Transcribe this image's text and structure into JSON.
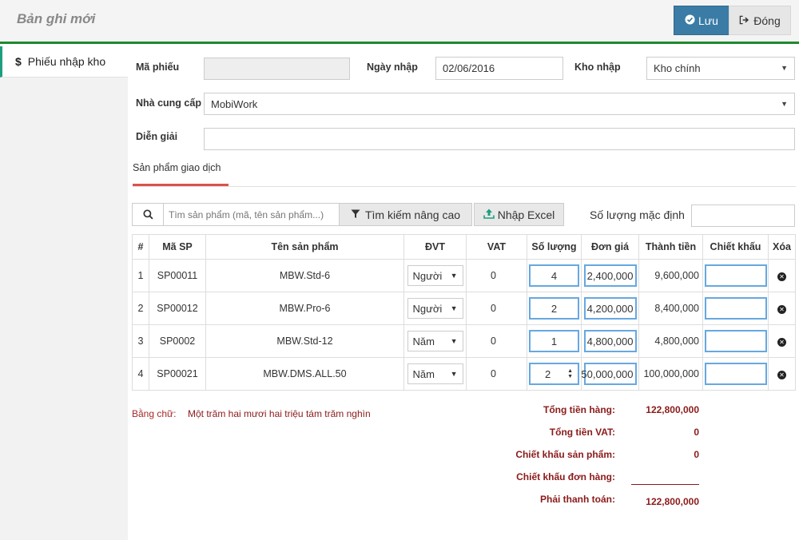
{
  "header": {
    "title": "Bản ghi mới",
    "save_label": "Lưu",
    "close_label": "Đóng"
  },
  "sidebar": {
    "items": [
      {
        "icon": "dollar-icon",
        "label": "Phiếu nhập kho"
      }
    ]
  },
  "form": {
    "ma_phieu_label": "Mã phiếu",
    "ma_phieu_value": "",
    "ngay_nhap_label": "Ngày nhập",
    "ngay_nhap_value": "02/06/2016",
    "kho_nhap_label": "Kho nhập",
    "kho_nhap_value": "Kho chính",
    "nha_cung_cap_label": "Nhà cung cấp",
    "nha_cung_cap_value": "MobiWork",
    "dien_giai_label": "Diễn giải",
    "dien_giai_value": ""
  },
  "tabs": {
    "active": "Sản phẩm giao dịch"
  },
  "toolbar": {
    "search_placeholder": "Tìm sản phẩm (mã, tên sản phẩm...)",
    "advanced_search_label": "Tìm kiếm nâng cao",
    "import_excel_label": "Nhập Excel",
    "default_qty_label": "Số lượng mặc định",
    "default_qty_value": ""
  },
  "table": {
    "headers": [
      "#",
      "Mã SP",
      "Tên sản phẩm",
      "ĐVT",
      "VAT",
      "Số lượng",
      "Đơn giá",
      "Thành tiền",
      "Chiết khấu",
      "Xóa"
    ],
    "rows": [
      {
        "no": "1",
        "code": "SP00011",
        "name": "MBW.Std-6",
        "unit": "Người",
        "vat": "0",
        "qty": "4",
        "price": "2,400,000",
        "total": "9,600,000",
        "discount": ""
      },
      {
        "no": "2",
        "code": "SP00012",
        "name": "MBW.Pro-6",
        "unit": "Người",
        "vat": "0",
        "qty": "2",
        "price": "4,200,000",
        "total": "8,400,000",
        "discount": ""
      },
      {
        "no": "3",
        "code": "SP0002",
        "name": "MBW.Std-12",
        "unit": "Năm",
        "vat": "0",
        "qty": "1",
        "price": "4,800,000",
        "total": "4,800,000",
        "discount": ""
      },
      {
        "no": "4",
        "code": "SP00021",
        "name": "MBW.DMS.ALL.50",
        "unit": "Năm",
        "vat": "0",
        "qty": "2",
        "price": "50,000,000",
        "total": "100,000,000",
        "discount": ""
      }
    ]
  },
  "summary": {
    "words_label": "Bằng chữ:",
    "words_value": "Một trăm hai mươi hai triệu tám trăm nghìn",
    "tong_tien_hang_label": "Tổng tiền hàng:",
    "tong_tien_hang_value": "122,800,000",
    "tong_tien_vat_label": "Tổng tiền VAT:",
    "tong_tien_vat_value": "0",
    "chiet_khau_sp_label": "Chiết khấu sản phẩm:",
    "chiet_khau_sp_value": "0",
    "chiet_khau_dh_label": "Chiết khấu đơn hàng:",
    "chiet_khau_dh_value": "",
    "phai_thanh_toan_label": "Phải thanh toán:",
    "phai_thanh_toan_value": "122,800,000"
  },
  "colors": {
    "accent_green": "#1e8a2e",
    "save_button": "#3a7ca5",
    "tab_underline": "#d9534f",
    "totals_text": "#8b1a1a",
    "input_focus_border": "#66a8e0"
  }
}
